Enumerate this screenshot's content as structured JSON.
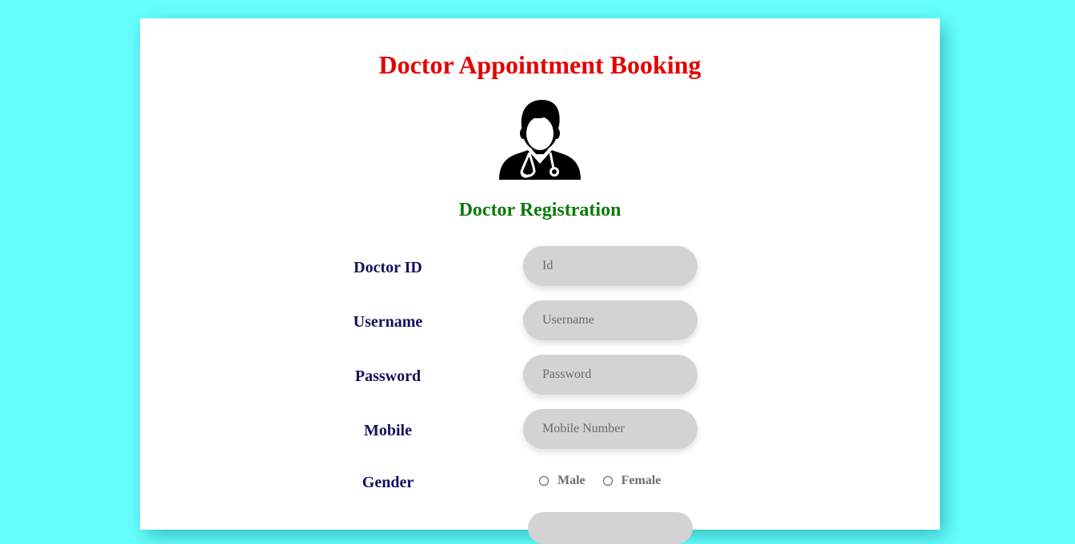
{
  "page": {
    "title": "Doctor Appointment Booking",
    "icon": "doctor-stethoscope-icon",
    "subtitle": "Doctor Registration"
  },
  "form": {
    "doctor_id": {
      "label": "Doctor ID",
      "placeholder": "Id",
      "value": ""
    },
    "username": {
      "label": "Username",
      "placeholder": "Username",
      "value": ""
    },
    "password": {
      "label": "Password",
      "placeholder": "Password",
      "value": ""
    },
    "mobile": {
      "label": "Mobile",
      "placeholder": "Mobile Number",
      "value": ""
    },
    "gender": {
      "label": "Gender",
      "options": [
        "Male",
        "Female"
      ],
      "selected": null
    }
  },
  "colors": {
    "background": "#66ffff",
    "card": "#ffffff",
    "title": "#e60000",
    "subtitle": "#0b7a0b",
    "label": "#14115c",
    "input_bg": "#d3d3d3"
  }
}
